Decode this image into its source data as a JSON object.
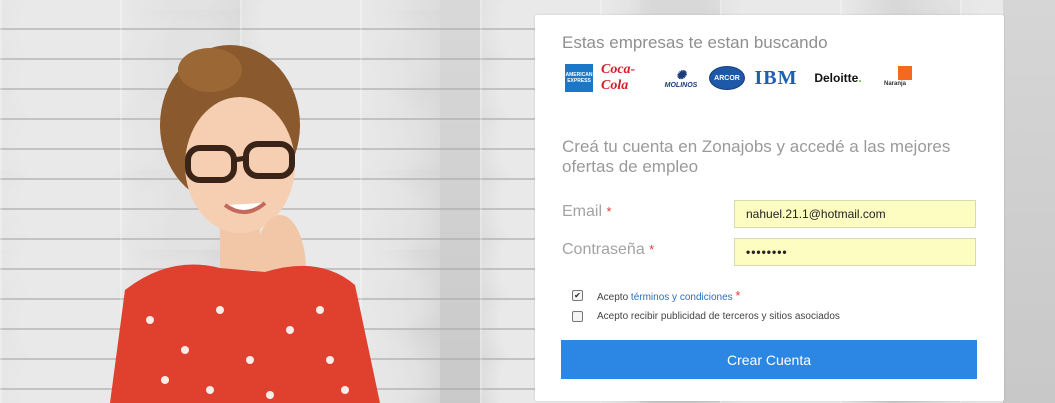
{
  "hero": {
    "image": "woman-with-glasses-photo"
  },
  "companies": {
    "title": "Estas empresas te estan buscando",
    "logos": [
      {
        "name": "amex-logo",
        "text": "AMERICAN EXPRESS"
      },
      {
        "name": "coca-cola-logo",
        "text": "Coca-Cola"
      },
      {
        "name": "molinos-logo",
        "text": "MOLINOS"
      },
      {
        "name": "arcor-logo",
        "text": "ARCOR"
      },
      {
        "name": "ibm-logo",
        "text": "IBM"
      },
      {
        "name": "deloitte-logo",
        "text": "Deloitte"
      },
      {
        "name": "naranja-logo",
        "text": "Naranja"
      }
    ]
  },
  "form": {
    "subtitle": "Creá tu cuenta en Zonajobs y accedé a las mejores ofertas de empleo",
    "email_label": "Email",
    "email_value": "nahuel.21.1@hotmail.com",
    "password_label": "Contraseña",
    "password_value": "••••••••",
    "required_mark": "*",
    "terms_prefix": "Acepto ",
    "terms_link": "términos y condiciones",
    "terms_checked": true,
    "ads_label": "Acepto recibir publicidad de terceros y sitios asociados",
    "ads_checked": false,
    "submit_label": "Crear Cuenta"
  },
  "colors": {
    "primary": "#2b87e3",
    "input_bg": "#fdfdc2",
    "required": "#e03c3c",
    "link": "#2f6db6"
  }
}
